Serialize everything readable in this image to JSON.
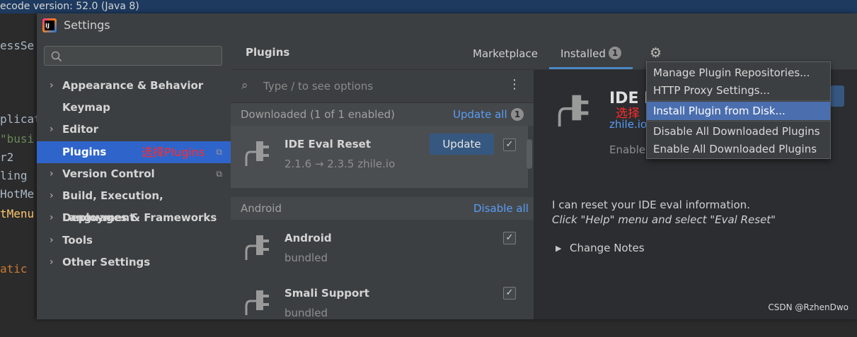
{
  "background": {
    "topbar_text": "ecode version: 52.0 (Java 8)",
    "code_lines": [
      "essSe",
      "plicat",
      "\"busi",
      "r2",
      "ling",
      "HotMe",
      "tMenu",
      "atic"
    ]
  },
  "window": {
    "title": "Settings",
    "search_placeholder": "",
    "sidebar": [
      {
        "label": "Appearance & Behavior",
        "chevron": "›"
      },
      {
        "label": "Keymap",
        "chevron": ""
      },
      {
        "label": "Editor",
        "chevron": "›"
      },
      {
        "label": "Plugins",
        "chevron": "",
        "selected": true
      },
      {
        "label": "Version Control",
        "chevron": "›"
      },
      {
        "label": "Build, Execution, Deployment",
        "chevron": "›"
      },
      {
        "label": "Languages & Frameworks",
        "chevron": "›"
      },
      {
        "label": "Tools",
        "chevron": "›"
      },
      {
        "label": "Other Settings",
        "chevron": "›"
      }
    ],
    "annotation_plugins": "选择Plugins",
    "accent_color": "#2f65ca"
  },
  "plugins": {
    "title": "Plugins",
    "tabs": {
      "marketplace": "Marketplace",
      "installed": "Installed",
      "installed_badge": "1"
    },
    "search_placeholder": "Type / to see options",
    "downloaded": {
      "header": "Downloaded (1 of 1 enabled)",
      "action": "Update all",
      "badge": "1"
    },
    "eval_reset": {
      "name": "IDE Eval Reset",
      "version": "2.1.6 → 2.3.5  zhile.io",
      "update_label": "Update",
      "checked": "✓"
    },
    "android_section": {
      "header": "Android",
      "action": "Disable all"
    },
    "android": {
      "name": "Android",
      "sub": "bundled",
      "checked": "✓"
    },
    "smali": {
      "name": "Smali Support",
      "sub": "bundled",
      "checked": "✓"
    }
  },
  "detail": {
    "name": "IDE E",
    "link": "zhile.io",
    "status": "Enablec",
    "annotation": "选择",
    "description_line1": "I can reset your IDE eval information.",
    "description_line2": "Click \"Help\" menu and select \"Eval Reset\"",
    "change_notes": "Change Notes"
  },
  "gear_menu": {
    "items": [
      "Manage Plugin Repositories...",
      "HTTP Proxy Settings...",
      "Install Plugin from Disk...",
      "Disable All Downloaded Plugins",
      "Enable All Downloaded Plugins"
    ],
    "selected_index": 2
  },
  "watermark": "CSDN @RzhenDwo"
}
